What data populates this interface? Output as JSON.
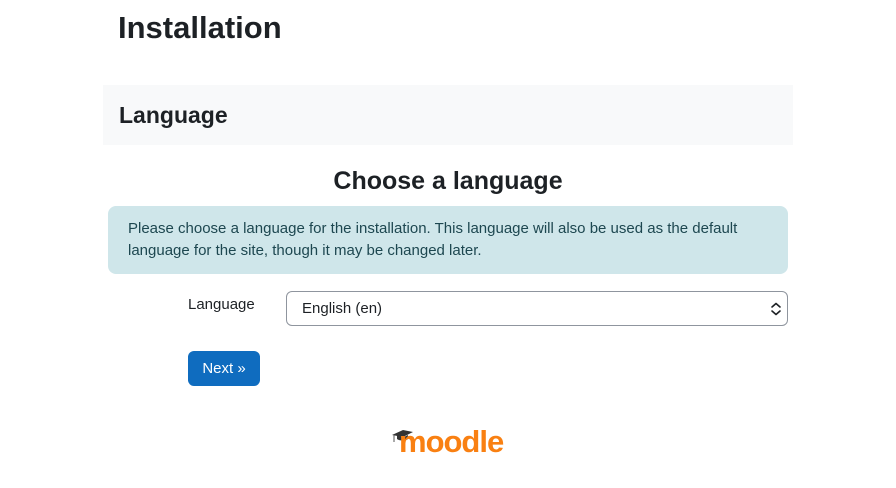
{
  "header": {
    "title": "Installation"
  },
  "section": {
    "title": "Language"
  },
  "main": {
    "heading": "Choose a language",
    "info_text": "Please choose a language for the installation. This language will also be used as the default language for the site, though it may be changed later.",
    "language_field": {
      "label": "Language",
      "selected": "English (en)"
    },
    "next_label": "Next »"
  },
  "footer": {
    "logo_text": "moodle"
  },
  "colors": {
    "primary_button": "#0f6cbf",
    "info_background": "#cfe6ea",
    "logo_orange": "#f98012",
    "logo_dark": "#333333"
  },
  "icons": {
    "select_arrow": "chevron-up-down-icon",
    "logo_cap": "graduation-cap-icon"
  }
}
